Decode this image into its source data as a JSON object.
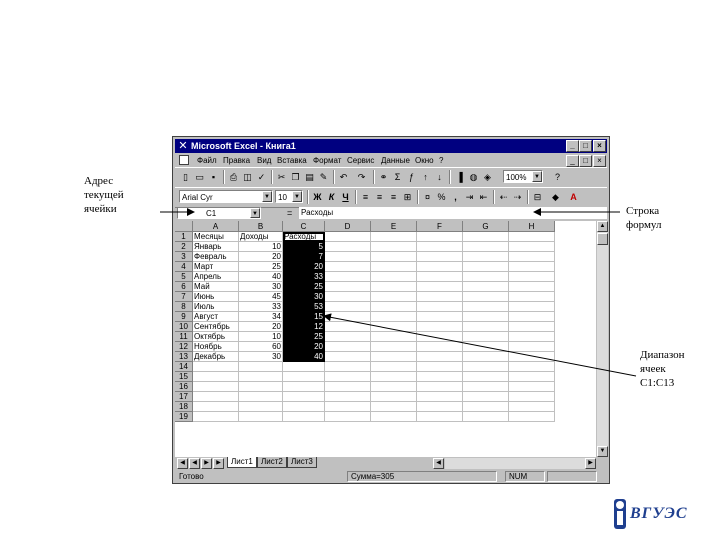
{
  "annotations": {
    "cell_address": "Адрес\nтекущей\nячейки",
    "formula_bar": "Строка\nформул",
    "range": "Диапазон\nячеек\nC1:C13"
  },
  "window": {
    "title": "Microsoft Excel - Книга1",
    "controls": {
      "minimize": "_",
      "maximize": "□",
      "close": "×"
    }
  },
  "menu": [
    "Файл",
    "Правка",
    "Вид",
    "Вставка",
    "Формат",
    "Сервис",
    "Данные",
    "Окно",
    "?"
  ],
  "toolbar": {
    "zoom": "100%",
    "font_name": "Arial Cyr",
    "font_size": "10",
    "bold": "Ж",
    "italic": "К",
    "underline": "Ч",
    "percent": "%",
    "comma": ","
  },
  "formula_bar": {
    "name_box": "C1",
    "equals": "=",
    "formula": "Расходы"
  },
  "columns": [
    "A",
    "B",
    "C",
    "D",
    "E",
    "F",
    "G",
    "H"
  ],
  "row_numbers": [
    "1",
    "2",
    "3",
    "4",
    "5",
    "6",
    "7",
    "8",
    "9",
    "10",
    "11",
    "12",
    "13",
    "14",
    "15",
    "16",
    "17",
    "18",
    "19"
  ],
  "table": {
    "header": [
      "Месяцы",
      "Доходы",
      "Расходы"
    ],
    "rows": [
      [
        "Январь",
        "10",
        "5"
      ],
      [
        "Февраль",
        "20",
        "7"
      ],
      [
        "Март",
        "25",
        "20"
      ],
      [
        "Апрель",
        "40",
        "33"
      ],
      [
        "Май",
        "30",
        "25"
      ],
      [
        "Июнь",
        "45",
        "30"
      ],
      [
        "Июль",
        "33",
        "53"
      ],
      [
        "Август",
        "34",
        "15"
      ],
      [
        "Сентябрь",
        "20",
        "12"
      ],
      [
        "Октябрь",
        "10",
        "25"
      ],
      [
        "Ноябрь",
        "60",
        "20"
      ],
      [
        "Декабрь",
        "30",
        "40"
      ]
    ]
  },
  "sheet_tabs": [
    "Лист1",
    "Лист2",
    "Лист3"
  ],
  "status": {
    "ready": "Готово",
    "sum": "Сумма=305",
    "num": "NUM"
  },
  "logo_text": "ВГУЭС",
  "colors": {
    "title_bar": "#000080",
    "selection": "#000000",
    "face": "#c0c0c0",
    "logo": "#1f3f8f"
  }
}
